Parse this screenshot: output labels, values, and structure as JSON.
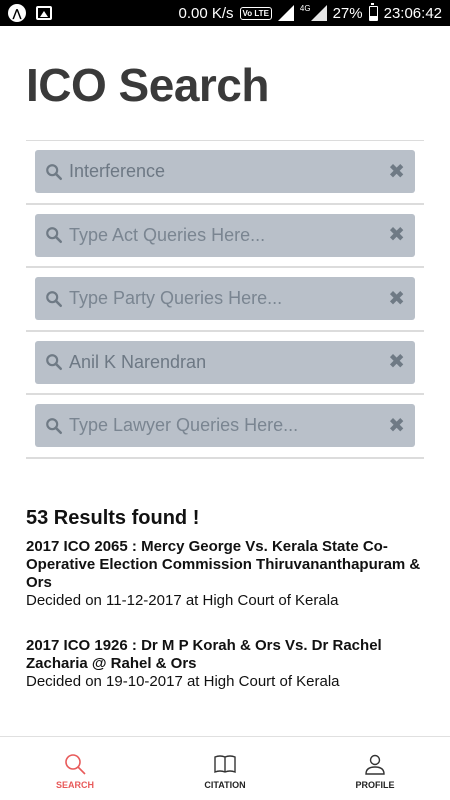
{
  "status_bar": {
    "network_speed": "0.00 K/s",
    "volte_label": "Vo LTE",
    "network_type": "4G",
    "battery_level": "27%",
    "battery_fraction": 0.27,
    "time": "23:06:42"
  },
  "page_title": "ICO Search",
  "search_fields": [
    {
      "value": "Interference",
      "placeholder": "",
      "filled": true
    },
    {
      "value": "",
      "placeholder": "Type Act Queries Here...",
      "filled": false
    },
    {
      "value": "",
      "placeholder": "Type Party Queries Here...",
      "filled": false
    },
    {
      "value": "Anil K Narendran",
      "placeholder": "",
      "filled": true
    },
    {
      "value": "",
      "placeholder": "Type Lawyer Queries Here...",
      "filled": false
    }
  ],
  "results": {
    "count_text": "53 Results found !",
    "items": [
      {
        "title": "2017 ICO 2065 : Mercy George Vs. Kerala State Co-Operative Election Commission Thiruvananthapuram & Ors",
        "meta": "Decided on 11-12-2017 at High Court of Kerala"
      },
      {
        "title": "2017 ICO 1926 : Dr M P Korah & Ors Vs. Dr Rachel Zacharia @ Rahel & Ors",
        "meta": "Decided on 19-10-2017 at High Court of Kerala"
      }
    ]
  },
  "bottom_nav": {
    "tabs": [
      {
        "label": "SEARCH",
        "icon": "search-icon",
        "active": true
      },
      {
        "label": "CITATION",
        "icon": "book-icon",
        "active": false
      },
      {
        "label": "PROFILE",
        "icon": "user-icon",
        "active": false
      }
    ]
  },
  "colors": {
    "accent": "#e85a5a",
    "field_bg": "#b9c0c9",
    "title": "#3a3a3a"
  }
}
